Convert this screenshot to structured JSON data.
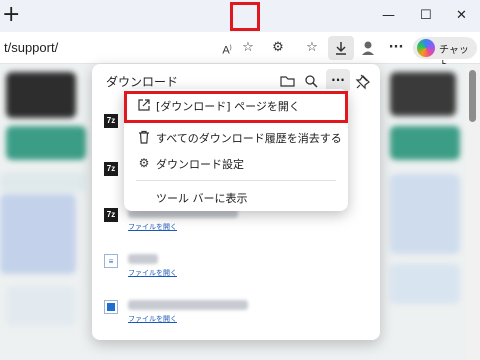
{
  "browser": {
    "new_tab": "+",
    "window_controls": {
      "minimize": "—",
      "maximize": "☐",
      "close": "✕"
    },
    "address": "t/support/",
    "toolbar_icons": [
      "read-aloud-icon",
      "favorite-star-icon",
      "extensions-icon",
      "favorites-icon",
      "download-icon",
      "profile-icon",
      "more-icon"
    ],
    "chat_label": "チャット"
  },
  "downloads_panel": {
    "title": "ダウンロード",
    "icons": [
      "folder-icon",
      "search-icon",
      "more-icon",
      "pin-icon"
    ],
    "items": [
      {
        "icon": "7z",
        "link": ""
      },
      {
        "icon": "7z",
        "link": ""
      },
      {
        "icon": "7z",
        "link": "ファイルを開く"
      },
      {
        "icon": "doc",
        "link": "ファイルを開く"
      },
      {
        "icon": "app",
        "link": "ファイルを開く"
      }
    ]
  },
  "context_menu": {
    "items": [
      {
        "icon": "open-external-icon",
        "label": "[ダウンロード] ページを開く"
      },
      {
        "icon": "trash-icon",
        "label": "すべてのダウンロード履歴を消去する"
      },
      {
        "icon": "gear-icon",
        "label": "ダウンロード設定"
      },
      {
        "icon": "",
        "label": "ツール バーに表示"
      }
    ]
  },
  "highlight_color": "#e1171e"
}
